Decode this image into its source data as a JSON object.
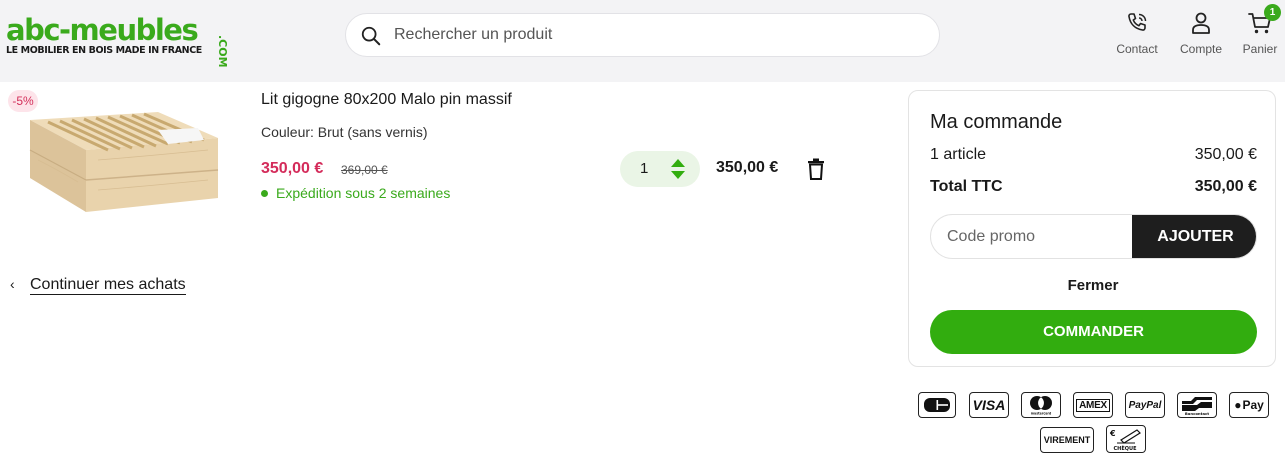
{
  "header": {
    "logo_text": "abc-meubles",
    "logo_com": ".COM",
    "logo_tagline": "LE MOBILIER EN BOIS MADE IN FRANCE",
    "search_placeholder": "Rechercher un produit",
    "contact_label": "Contact",
    "account_label": "Compte",
    "cart_label": "Panier",
    "cart_count": "1",
    "accent": "#3aaa1c"
  },
  "cart": {
    "item": {
      "discount_badge": "-5%",
      "title": "Lit gigogne 80x200 Malo pin massif",
      "color": "Couleur: Brut (sans vernis)",
      "price_now": "350,00 €",
      "price_old": "369,00 €",
      "shipping": "Expédition sous 2 semaines",
      "quantity": "1",
      "line_total": "350,00 €",
      "image_icon": "bed-frame-image"
    },
    "continue_label": "Continuer mes achats"
  },
  "order": {
    "title": "Ma commande",
    "articles_label": "1 article",
    "articles_value": "350,00 €",
    "total_label": "Total TTC",
    "total_value": "350,00 €",
    "promo_placeholder": "Code promo",
    "promo_button": "AJOUTER",
    "close_label": "Fermer",
    "checkout_button": "COMMANDER",
    "checkout_color": "#32ad0f"
  },
  "payments": {
    "cb": "CB",
    "visa": "VISA",
    "mastercard": "mastercard",
    "amex": "AMEX",
    "paypal": "PayPal",
    "bancontact": "Bancontact",
    "applepay": "Pay",
    "virement": "VIREMENT",
    "cheque": "CHÈQUE"
  }
}
